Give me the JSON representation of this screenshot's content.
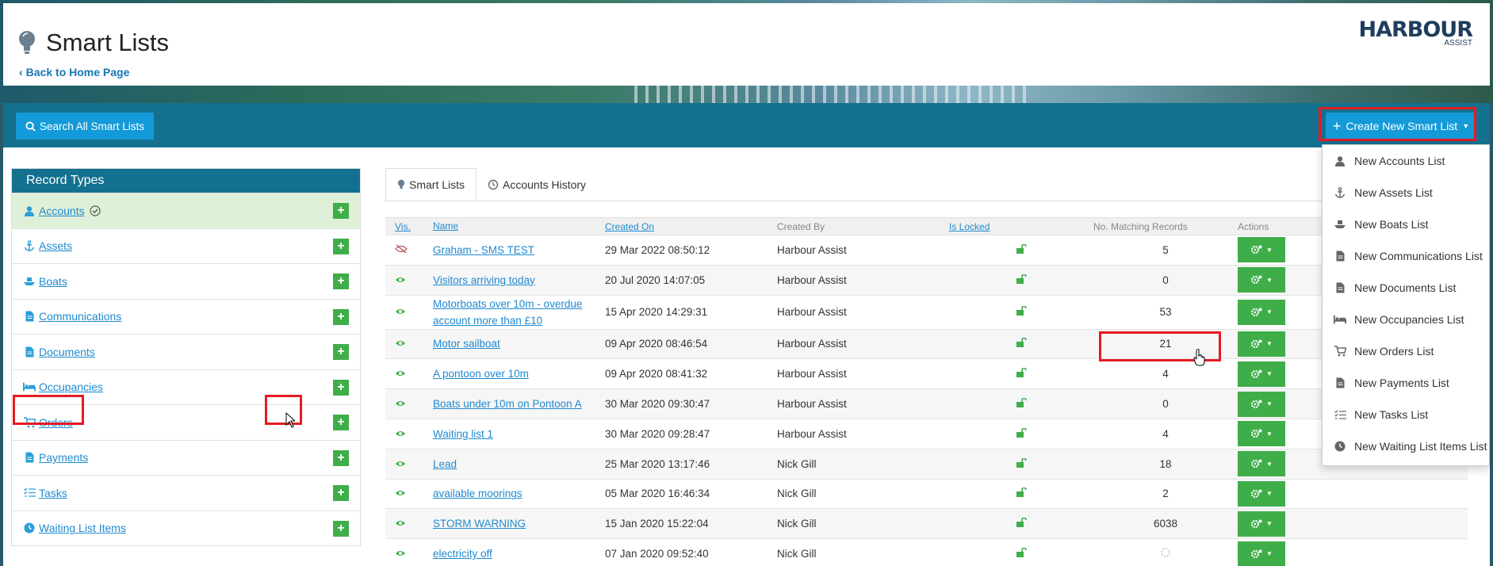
{
  "page": {
    "title": "Smart Lists",
    "back_link": "Back to Home Page",
    "logo_main": "HARBOUR",
    "logo_sub": "ASSIST"
  },
  "toolbar": {
    "search_label": "Search All Smart Lists",
    "create_label": "Create New Smart List"
  },
  "sidebar": {
    "heading": "Record Types",
    "items": [
      {
        "label": "Accounts",
        "icon": "person-icon"
      },
      {
        "label": "Assets",
        "icon": "anchor-icon"
      },
      {
        "label": "Boats",
        "icon": "boat-icon"
      },
      {
        "label": "Communications",
        "icon": "document-icon"
      },
      {
        "label": "Documents",
        "icon": "document-icon"
      },
      {
        "label": "Occupancies",
        "icon": "bed-icon"
      },
      {
        "label": "Orders",
        "icon": "cart-icon"
      },
      {
        "label": "Payments",
        "icon": "document-icon"
      },
      {
        "label": "Tasks",
        "icon": "tasks-icon"
      },
      {
        "label": "Waiting List Items",
        "icon": "clock-icon"
      }
    ],
    "add_label": "+"
  },
  "tabs": [
    {
      "label": "Smart Lists",
      "icon": "bulb-icon",
      "active": true
    },
    {
      "label": "Accounts History",
      "icon": "history-icon",
      "active": false
    }
  ],
  "table": {
    "headers": {
      "vis": "Vis.",
      "name": "Name",
      "created_on": "Created On",
      "created_by": "Created By",
      "is_locked": "Is Locked",
      "matching": "No. Matching Records",
      "actions": "Actions"
    },
    "rows": [
      {
        "hidden": true,
        "name": "Graham - SMS TEST",
        "created_on": "29 Mar 2022 08:50:12",
        "created_by": "Harbour Assist",
        "count": "5"
      },
      {
        "hidden": false,
        "name": "Visitors arriving today",
        "created_on": "20 Jul 2020 14:07:05",
        "created_by": "Harbour Assist",
        "count": "0"
      },
      {
        "hidden": false,
        "name": "Motorboats over 10m - overdue account more than £10",
        "created_on": "15 Apr 2020 14:29:31",
        "created_by": "Harbour Assist",
        "count": "53"
      },
      {
        "hidden": false,
        "name": "Motor sailboat",
        "created_on": "09 Apr 2020 08:46:54",
        "created_by": "Harbour Assist",
        "count": "21"
      },
      {
        "hidden": false,
        "name": "A pontoon over 10m",
        "created_on": "09 Apr 2020 08:41:32",
        "created_by": "Harbour Assist",
        "count": "4"
      },
      {
        "hidden": false,
        "name": "Boats under 10m on Pontoon A",
        "created_on": "30 Mar 2020 09:30:47",
        "created_by": "Harbour Assist",
        "count": "0"
      },
      {
        "hidden": false,
        "name": "Waiting list 1",
        "created_on": "30 Mar 2020 09:28:47",
        "created_by": "Harbour Assist",
        "count": "4"
      },
      {
        "hidden": false,
        "name": "Lead",
        "created_on": "25 Mar 2020 13:17:46",
        "created_by": "Nick Gill",
        "count": "18"
      },
      {
        "hidden": false,
        "name": "available moorings",
        "created_on": "05 Mar 2020 16:46:34",
        "created_by": "Nick Gill",
        "count": "2"
      },
      {
        "hidden": false,
        "name": "STORM WARNING",
        "created_on": "15 Jan 2020 15:22:04",
        "created_by": "Nick Gill",
        "count": "6038"
      },
      {
        "hidden": false,
        "name": "electricity off",
        "created_on": "07 Jan 2020 09:52:40",
        "created_by": "Nick Gill",
        "count": ""
      }
    ]
  },
  "dropdown": {
    "items": [
      {
        "label": "New Accounts List",
        "icon": "person-icon"
      },
      {
        "label": "New Assets List",
        "icon": "anchor-icon"
      },
      {
        "label": "New Boats List",
        "icon": "boat-icon"
      },
      {
        "label": "New Communications List",
        "icon": "document-icon"
      },
      {
        "label": "New Documents List",
        "icon": "document-icon"
      },
      {
        "label": "New Occupancies List",
        "icon": "bed-icon"
      },
      {
        "label": "New Orders List",
        "icon": "cart-icon"
      },
      {
        "label": "New Payments List",
        "icon": "document-icon"
      },
      {
        "label": "New Tasks List",
        "icon": "tasks-icon"
      },
      {
        "label": "New Waiting List Items List",
        "icon": "clock-icon"
      }
    ]
  },
  "colors": {
    "toolbar": "#13718f",
    "button_blue": "#149ad8",
    "add_green": "#3fae49",
    "link_blue": "#1f8ad0",
    "highlight_red": "#e41b23",
    "active_green": "#dff0d8"
  }
}
